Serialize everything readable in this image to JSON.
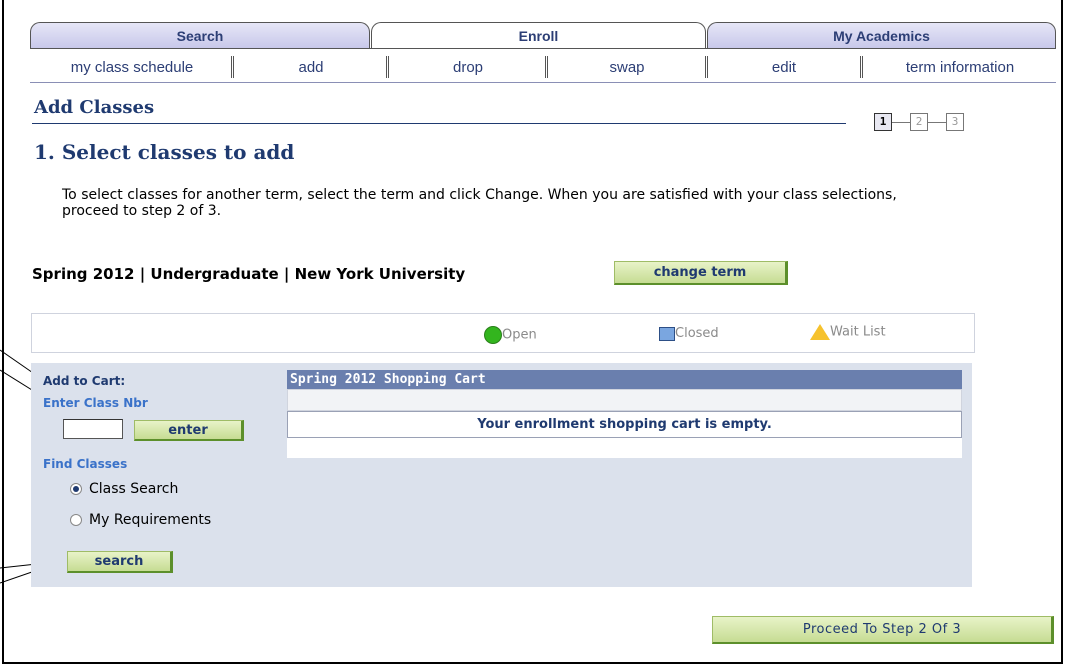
{
  "tabs": [
    {
      "label": "Search",
      "active": false
    },
    {
      "label": "Enroll",
      "active": true
    },
    {
      "label": "My Academics",
      "active": false
    }
  ],
  "subtabs": [
    {
      "label": "my class schedule",
      "active": false
    },
    {
      "label": "add",
      "active": true
    },
    {
      "label": "drop",
      "active": false
    },
    {
      "label": "swap",
      "active": false
    },
    {
      "label": "edit",
      "active": false
    },
    {
      "label": "term information",
      "active": false
    }
  ],
  "page": {
    "title": "Add Classes",
    "step_title": "1.  Select classes to add",
    "instructions": "To select classes for another term, select the term and click Change.  When you are satisfied with your class selections, proceed to step 2 of 3.",
    "steps": [
      "1",
      "2",
      "3"
    ],
    "current_step": 1
  },
  "term": {
    "text": "Spring 2012 | Undergraduate | New York University",
    "change_button": "change term"
  },
  "legend": {
    "open": "Open",
    "closed": "Closed",
    "wait_list": "Wait List"
  },
  "add_to_cart": {
    "heading": "Add to Cart:",
    "enter_label": "Enter Class Nbr",
    "class_nbr_value": "",
    "enter_button": "enter",
    "find_label": "Find Classes",
    "options": [
      "Class Search",
      "My Requirements"
    ],
    "selected_option": "Class Search",
    "search_button": "search"
  },
  "cart": {
    "title": "Spring 2012 Shopping Cart",
    "empty_message": "Your enrollment shopping cart is empty."
  },
  "proceed_button": "Proceed To Step 2 Of 3",
  "colors": {
    "brand_blue": "#1f3a70",
    "cart_header": "#6a7fae",
    "button_green": "#c6dc93",
    "open": "#33b51e",
    "closed": "#7aa6e0",
    "wait_list": "#f6c22d"
  }
}
